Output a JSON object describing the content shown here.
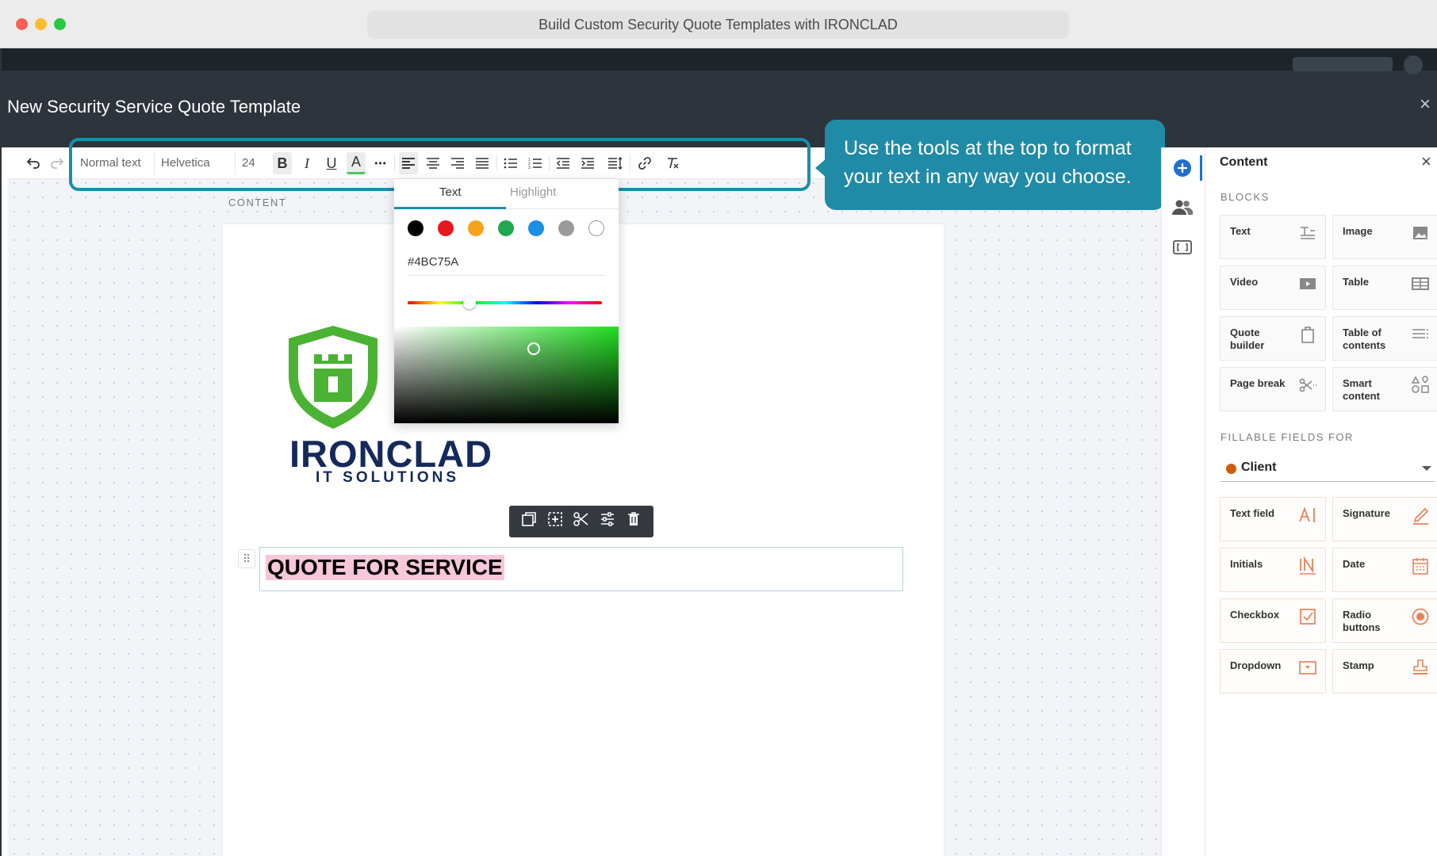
{
  "browser": {
    "title": "Build Custom Security Quote Templates with IRONCLAD"
  },
  "modal": {
    "title": "New Security Service Quote Template",
    "close_icon": "×"
  },
  "toolbar": {
    "style_value": "Normal text",
    "font_value": "Helvetica",
    "size_value": "24",
    "bold_label": "B",
    "italic_label": "I",
    "underline_label": "U",
    "text_color_label": "A",
    "more_label": "•••"
  },
  "tooltip": {
    "text": "Use the tools at the top to format your text in any way you choose."
  },
  "canvas": {
    "content_label": "CONTENT"
  },
  "color_picker": {
    "tabs": [
      "Text",
      "Highlight"
    ],
    "active_tab": "Text",
    "hex_value": "#4BC75A",
    "swatches": [
      "#000000",
      "#e8161e",
      "#f6a21b",
      "#1fa84f",
      "#1a8fe3",
      "#9a9a9a",
      "#ffffff"
    ]
  },
  "document": {
    "logo_title": "IRONCLAD",
    "logo_subtitle": "IT SOLUTIONS",
    "heading": "QUOTE FOR SERVICE"
  },
  "panel": {
    "title": "Content",
    "close_icon": "×",
    "blocks_label": "BLOCKS",
    "blocks": [
      {
        "label": "Text",
        "icon": "text-icon"
      },
      {
        "label": "Image",
        "icon": "image-icon"
      },
      {
        "label": "Video",
        "icon": "video-icon"
      },
      {
        "label": "Table",
        "icon": "table-icon"
      },
      {
        "label": "Quote builder",
        "icon": "quote-builder-icon"
      },
      {
        "label": "Table of contents",
        "icon": "table-of-contents-icon"
      },
      {
        "label": "Page break",
        "icon": "scissors-icon"
      },
      {
        "label": "Smart content",
        "icon": "smart-content-icon"
      }
    ],
    "fields_label": "FILLABLE FIELDS FOR",
    "role": "Client",
    "fields": [
      {
        "label": "Text field",
        "icon": "text-field-icon"
      },
      {
        "label": "Signature",
        "icon": "signature-icon"
      },
      {
        "label": "Initials",
        "icon": "initials-icon"
      },
      {
        "label": "Date",
        "icon": "calendar-icon"
      },
      {
        "label": "Checkbox",
        "icon": "checkbox-icon"
      },
      {
        "label": "Radio buttons",
        "icon": "radio-icon"
      },
      {
        "label": "Dropdown",
        "icon": "dropdown-icon"
      },
      {
        "label": "Stamp",
        "icon": "stamp-icon"
      }
    ]
  },
  "colors": {
    "accent": "#1f8ba6",
    "field_accent": "#e8825a",
    "brand_navy": "#15295a",
    "brand_green": "#4bb233"
  }
}
